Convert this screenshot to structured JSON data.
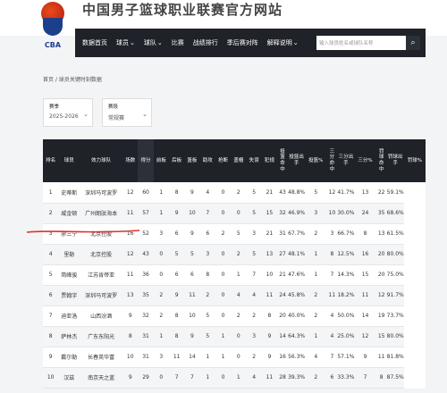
{
  "site": {
    "title": "中国男子篮球职业联赛官方网站",
    "logo_text": "CBA"
  },
  "nav": {
    "items": [
      {
        "label": "数据首页",
        "chevron": false
      },
      {
        "label": "球员",
        "chevron": true
      },
      {
        "label": "球队",
        "chevron": true
      },
      {
        "label": "比赛",
        "chevron": false
      },
      {
        "label": "战绩排行",
        "chevron": false
      },
      {
        "label": "季后赛对阵",
        "chevron": false
      },
      {
        "label": "解释说明",
        "chevron": true
      }
    ],
    "search_placeholder": "输入球员姓名或球队名称"
  },
  "breadcrumb": "首页 / 球员关键时刻数据",
  "filters": [
    {
      "label": "赛季",
      "value": "2025-2026"
    },
    {
      "label": "赛段",
      "value": "常规赛"
    }
  ],
  "table": {
    "columns": [
      "排名",
      "球员",
      "效力球队",
      "场数",
      "得分",
      "前板",
      "后板",
      "篮板",
      "助攻",
      "抢断",
      "盖帽",
      "失误",
      "犯规",
      "投篮命中",
      "投篮出手",
      "投篮%",
      "三分命中",
      "三分出手",
      "三分%",
      "罚球命中",
      "罚球出手",
      "罚球%"
    ],
    "rows": [
      [
        "1",
        "史蒂斯",
        "深圳马可波罗",
        "12",
        "60",
        "1",
        "8",
        "9",
        "4",
        "0",
        "2",
        "5",
        "21",
        "43",
        "48.8%",
        "5",
        "12",
        "41.7%",
        "13",
        "22",
        "59.1%"
      ],
      [
        "2",
        "威金顿",
        "广州朗肽海本",
        "11",
        "57",
        "1",
        "9",
        "10",
        "7",
        "0",
        "0",
        "5",
        "15",
        "32",
        "46.9%",
        "3",
        "10",
        "30.0%",
        "24",
        "35",
        "68.6%"
      ],
      [
        "3",
        "廖三宁",
        "北京控股",
        "16",
        "52",
        "3",
        "6",
        "9",
        "6",
        "2",
        "5",
        "3",
        "21",
        "31",
        "67.7%",
        "2",
        "3",
        "66.7%",
        "8",
        "13",
        "61.5%"
      ],
      [
        "4",
        "里勒",
        "北京控股",
        "12",
        "43",
        "0",
        "5",
        "5",
        "3",
        "0",
        "2",
        "5",
        "13",
        "27",
        "48.1%",
        "1",
        "8",
        "12.5%",
        "16",
        "20",
        "80.0%"
      ],
      [
        "5",
        "简峰骏",
        "江苏肯帝亚",
        "11",
        "36",
        "0",
        "6",
        "6",
        "8",
        "0",
        "1",
        "7",
        "10",
        "21",
        "47.6%",
        "1",
        "7",
        "14.3%",
        "15",
        "20",
        "75.0%"
      ],
      [
        "6",
        "贾翰宇",
        "深圳马可波罗",
        "13",
        "35",
        "2",
        "9",
        "11",
        "2",
        "0",
        "4",
        "4",
        "11",
        "24",
        "45.8%",
        "2",
        "11",
        "18.2%",
        "11",
        "12",
        "91.7%"
      ],
      [
        "7",
        "迪亚洛",
        "山西汾酒",
        "9",
        "32",
        "2",
        "8",
        "10",
        "5",
        "0",
        "2",
        "2",
        "8",
        "20",
        "40.0%",
        "2",
        "4",
        "50.0%",
        "14",
        "19",
        "73.7%"
      ],
      [
        "8",
        "萨林杰",
        "广东东阳光",
        "8",
        "31",
        "1",
        "8",
        "9",
        "5",
        "1",
        "0",
        "3",
        "9",
        "14",
        "64.3%",
        "1",
        "4",
        "25.0%",
        "12",
        "15",
        "80.0%"
      ],
      [
        "9",
        "戴尔勒",
        "长春英华富",
        "10",
        "31",
        "3",
        "11",
        "14",
        "1",
        "1",
        "0",
        "2",
        "9",
        "16",
        "56.3%",
        "4",
        "7",
        "57.1%",
        "9",
        "11",
        "81.8%"
      ],
      [
        "10",
        "汉兹",
        "南京天之蓝",
        "9",
        "29",
        "0",
        "7",
        "7",
        "1",
        "0",
        "1",
        "4",
        "11",
        "28",
        "39.3%",
        "2",
        "6",
        "33.3%",
        "7",
        "8",
        "87.5%"
      ]
    ]
  },
  "colors": {
    "nav_bg": "#1f2228",
    "annotation": "#e0322a"
  }
}
